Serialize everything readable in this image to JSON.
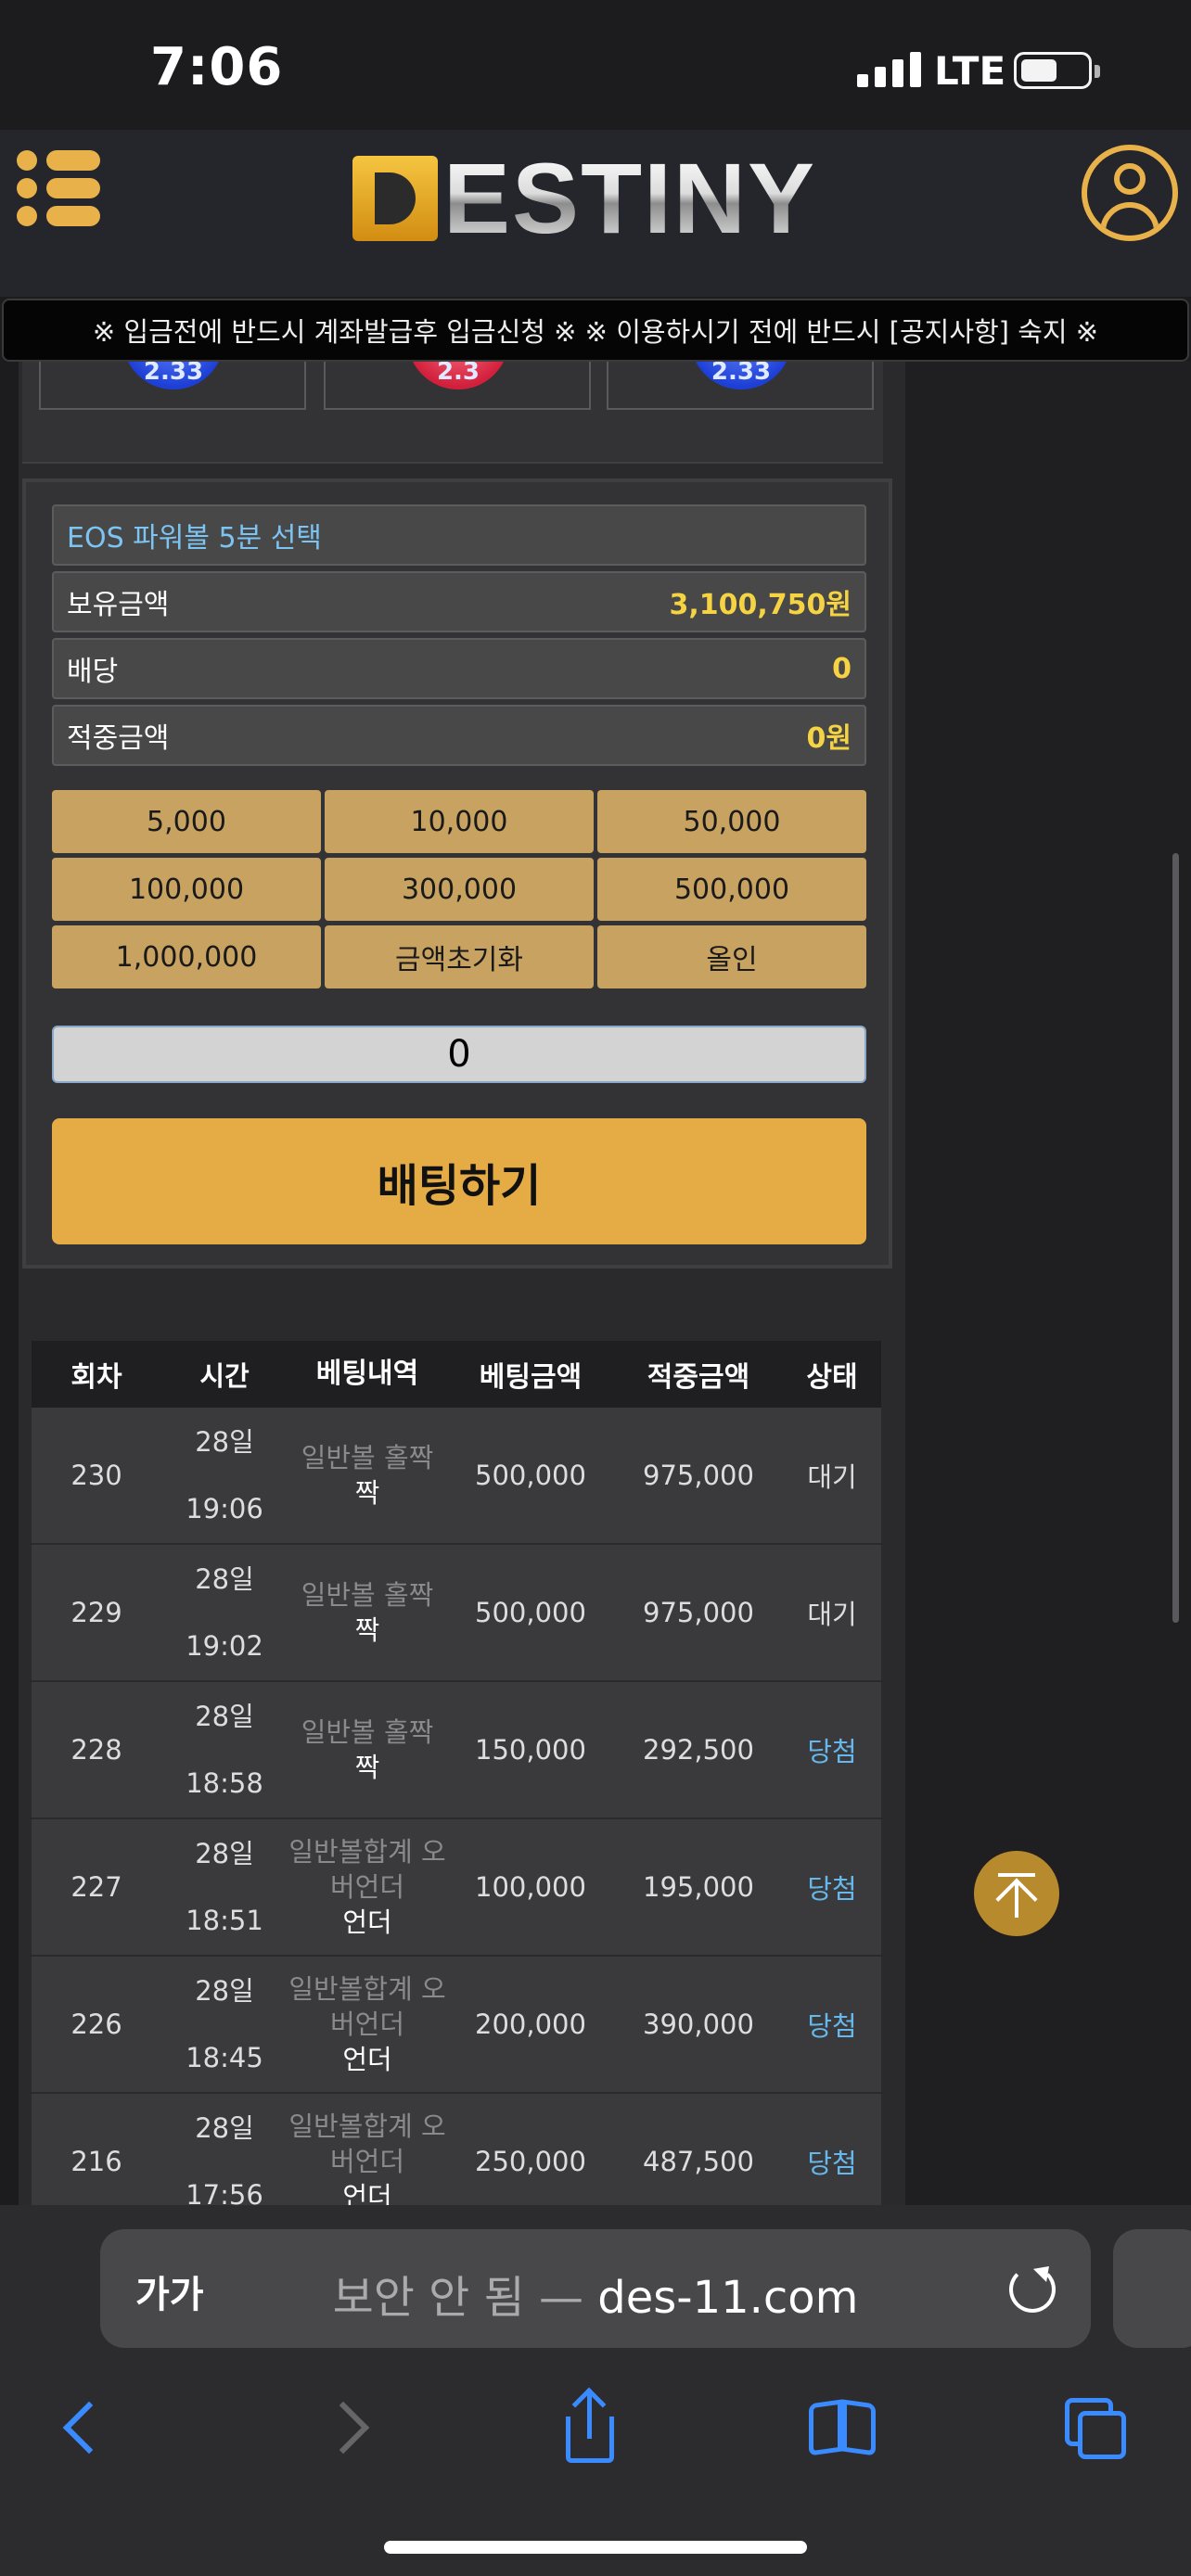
{
  "status": {
    "time": "7:06",
    "network": "LTE"
  },
  "header": {
    "logo_text": "ESTINY",
    "logo_mark": "D",
    "menu_icon": "hamburger-menu-icon",
    "user_icon": "user-profile-icon"
  },
  "notice": "※ 입금전에 반드시 계좌발급후 입금신청 ※ ※ 이용하시기 전에 반드시 [공지사항] 숙지 ※",
  "odds": [
    "2.33",
    "2.3",
    "2.33"
  ],
  "bet": {
    "game": "EOS 파워볼 5분 선택",
    "balance_label": "보유금액",
    "balance_value": "3,100,750원",
    "odds_label": "배당",
    "odds_value": "0",
    "win_label": "적중금액",
    "win_value": "0원",
    "chips": [
      "5,000",
      "10,000",
      "50,000",
      "100,000",
      "300,000",
      "500,000",
      "1,000,000",
      "금액초기화",
      "올인"
    ],
    "amount": "0",
    "submit": "배팅하기"
  },
  "history": {
    "headers": [
      "회차",
      "시간",
      "베팅내역",
      "베팅금액",
      "적중금액",
      "상태"
    ],
    "rows": [
      {
        "round": "230",
        "time": "28일 19:06",
        "type": "일반볼 홀짝",
        "pick": "짝",
        "amount": "500,000",
        "win": "975,000",
        "status": "대기"
      },
      {
        "round": "229",
        "time": "28일 19:02",
        "type": "일반볼 홀짝",
        "pick": "짝",
        "amount": "500,000",
        "win": "975,000",
        "status": "대기"
      },
      {
        "round": "228",
        "time": "28일 18:58",
        "type": "일반볼 홀짝",
        "pick": "짝",
        "amount": "150,000",
        "win": "292,500",
        "status": "당첨"
      },
      {
        "round": "227",
        "time": "28일 18:51",
        "type": "일반볼합계 오버언더",
        "pick": "언더",
        "amount": "100,000",
        "win": "195,000",
        "status": "당첨"
      },
      {
        "round": "226",
        "time": "28일 18:45",
        "type": "일반볼합계 오버언더",
        "pick": "언더",
        "amount": "200,000",
        "win": "390,000",
        "status": "당첨"
      },
      {
        "round": "216",
        "time": "28일 17:56",
        "type": "일반볼합계 오버언더",
        "pick": "언더",
        "amount": "250,000",
        "win": "487,500",
        "status": "당첨"
      }
    ]
  },
  "browser": {
    "text_size": "가가",
    "insecure": "보안 안 됨",
    "separator": "—",
    "domain": "des-11.com"
  },
  "colors": {
    "gold": "#e5ac45",
    "chip": "#c8a260",
    "value_yellow": "#f5d342",
    "win_blue": "#66b8ec",
    "ios_blue": "#3a8bff"
  }
}
